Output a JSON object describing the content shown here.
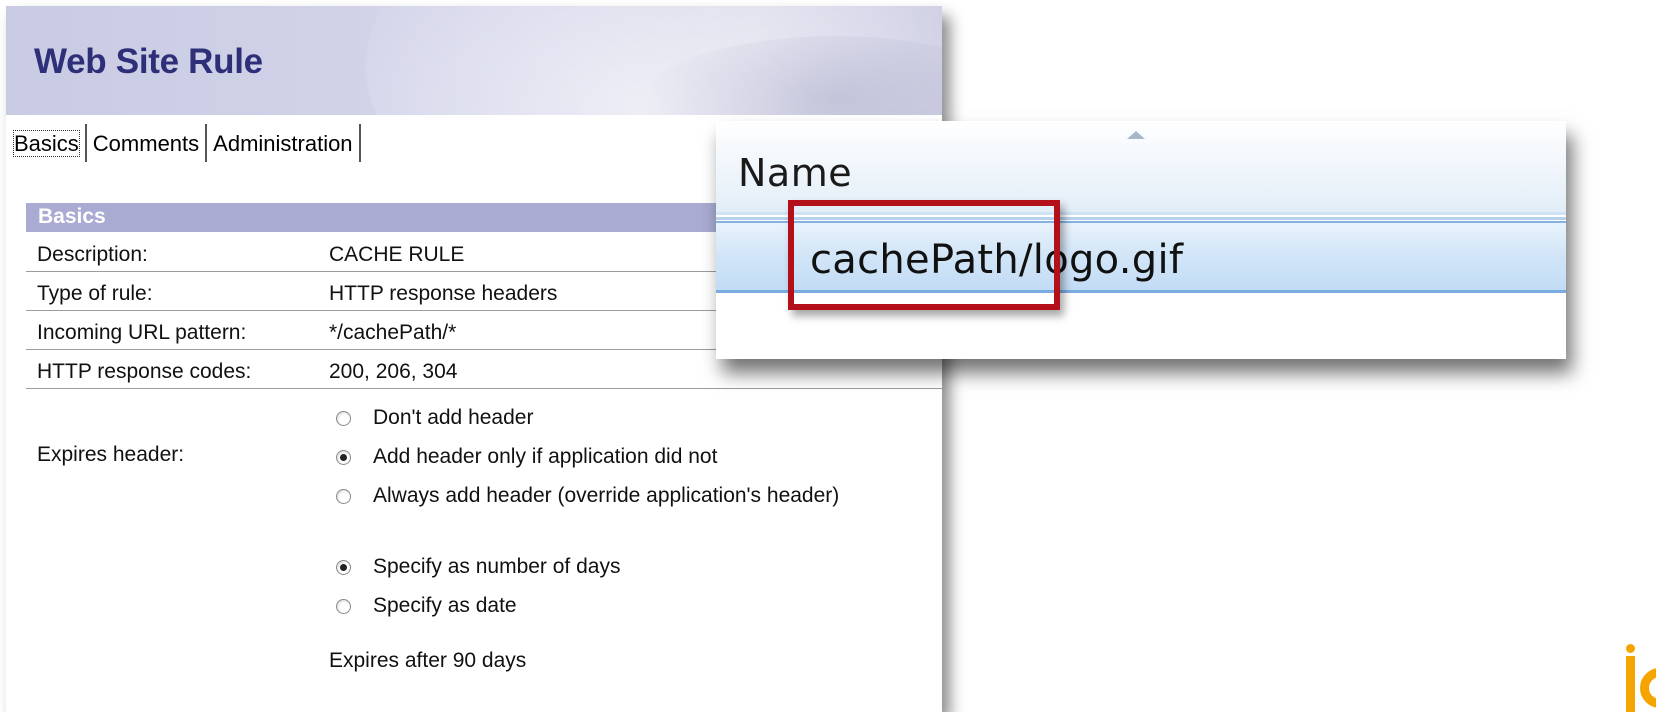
{
  "form": {
    "title": "Web Site Rule",
    "tabs": [
      {
        "label": "Basics",
        "active": true
      },
      {
        "label": "Comments",
        "active": false
      },
      {
        "label": "Administration",
        "active": false
      }
    ],
    "section_title": "Basics",
    "fields": [
      {
        "label": "Description:",
        "value": "CACHE RULE"
      },
      {
        "label": "Type of rule:",
        "value": "HTTP response headers"
      },
      {
        "label": "Incoming URL pattern:",
        "value": "*/cachePath/*"
      },
      {
        "label": "HTTP response codes:",
        "value": "200, 206, 304"
      }
    ],
    "expires": {
      "label": "Expires header:",
      "header_options": [
        {
          "label": "Don't add header",
          "checked": false
        },
        {
          "label": "Add header only if application did not",
          "checked": true
        },
        {
          "label": "Always add header (override application's header)",
          "checked": false
        }
      ],
      "mode_options": [
        {
          "label": "Specify as number of days",
          "checked": true
        },
        {
          "label": "Specify as date",
          "checked": false
        }
      ],
      "after_text": "Expires after 90 days"
    },
    "colors": {
      "title": "#2d2f78",
      "section_bar": "#a9abd2"
    }
  },
  "explorer": {
    "column_header": "Name",
    "file_name": "cachePath/logo.gif",
    "highlight_color": "#b4101a",
    "sort_icon": "sort-up-arrow"
  }
}
